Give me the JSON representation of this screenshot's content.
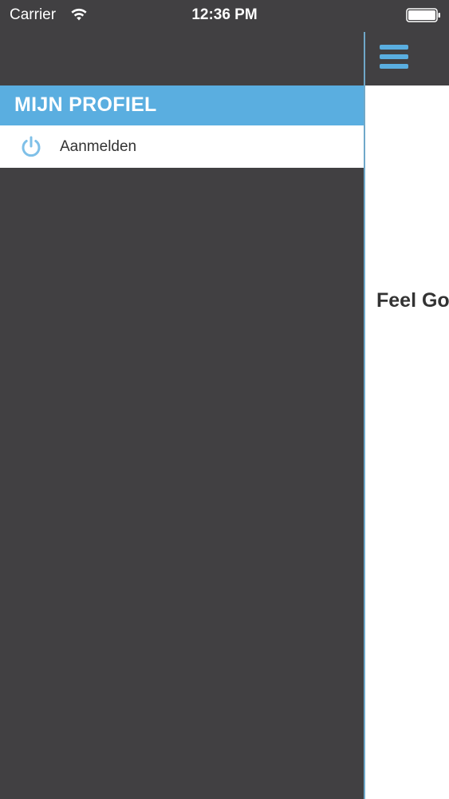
{
  "status_bar": {
    "carrier": "Carrier",
    "time": "12:36 PM",
    "icons": [
      "wifi-icon",
      "battery-icon"
    ]
  },
  "drawer": {
    "header_title": "MIJN PROFIEL",
    "items": [
      {
        "label": "Aanmelden",
        "icon": "power-icon"
      }
    ]
  },
  "main": {
    "navbar_icon": "menu-icon",
    "title": "Feel Go"
  },
  "colors": {
    "background_dark": "#414042",
    "accent_blue": "#5aaee0",
    "icon_blue": "#7fc0e8",
    "text_dark": "#333333",
    "white": "#ffffff"
  }
}
